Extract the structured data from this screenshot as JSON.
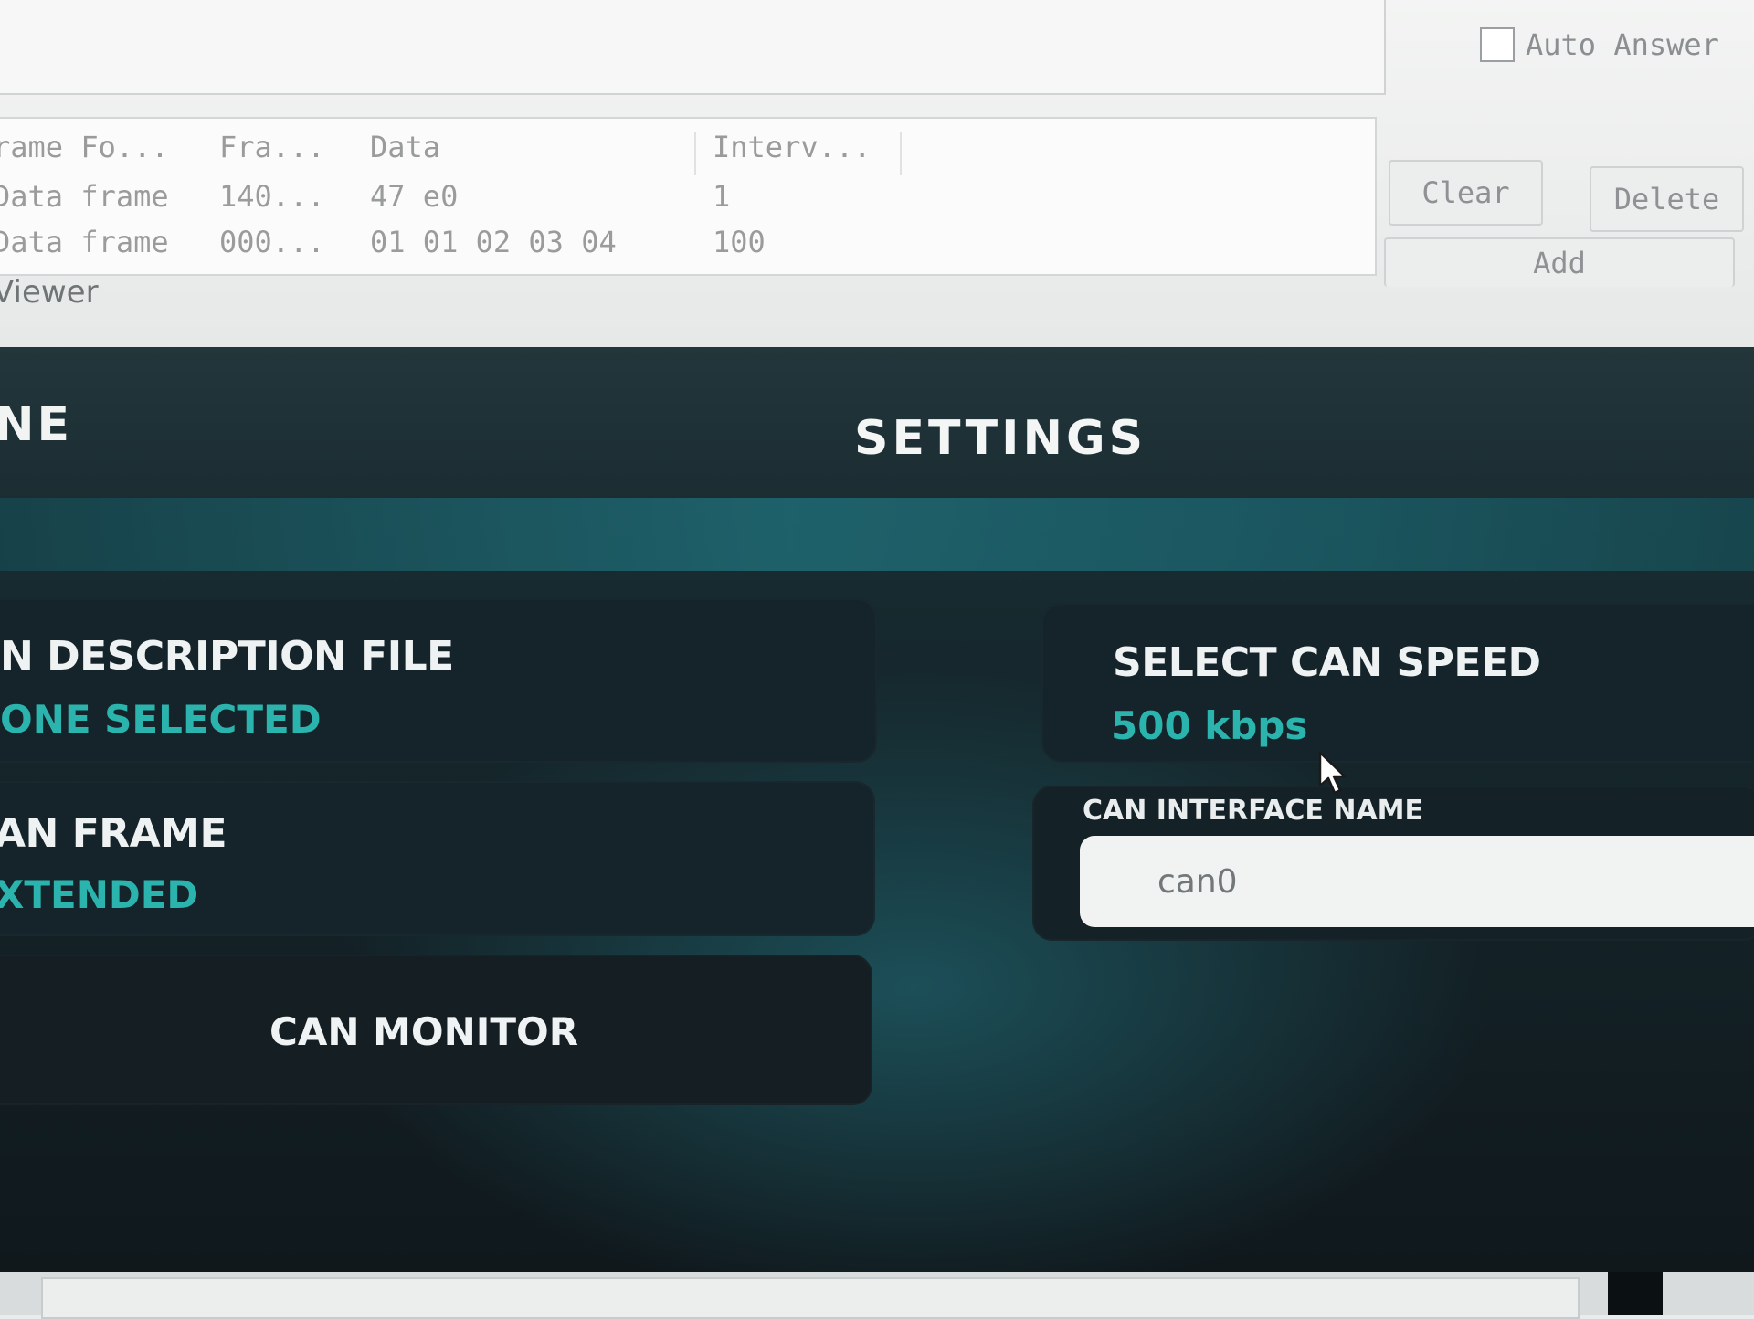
{
  "background_window": {
    "auto_answer_label": "Auto Answer",
    "table": {
      "headers": [
        "rame Fo...",
        "Fra...",
        "Data",
        "Interv..."
      ],
      "rows": [
        [
          "Data frame",
          "140...",
          "47 e0",
          "1"
        ],
        [
          "Data frame",
          "000...",
          "01 01 02 03 04",
          "100"
        ]
      ]
    },
    "buttons": {
      "clear": "Clear",
      "delete": "Delete",
      "add": "Add"
    },
    "viewer_label": "Viewer"
  },
  "app": {
    "header_left_partial": "NE",
    "header_title": "SETTINGS",
    "dbc_card": {
      "title": "N DESCRIPTION FILE",
      "value": "ONE SELECTED"
    },
    "frame_card": {
      "title": "AN FRAME",
      "value": "XTENDED"
    },
    "monitor_button": "CAN MONITOR",
    "speed_card": {
      "title": "SELECT CAN SPEED",
      "value": "500 kbps"
    },
    "iface_card": {
      "label": "CAN INTERFACE NAME",
      "value": "can0"
    }
  },
  "colors": {
    "accent_teal": "#2bb4ad",
    "panel_dark": "#15242a",
    "header_band": "#1f6a74"
  },
  "icons": [
    "mouse-pointer-icon"
  ]
}
